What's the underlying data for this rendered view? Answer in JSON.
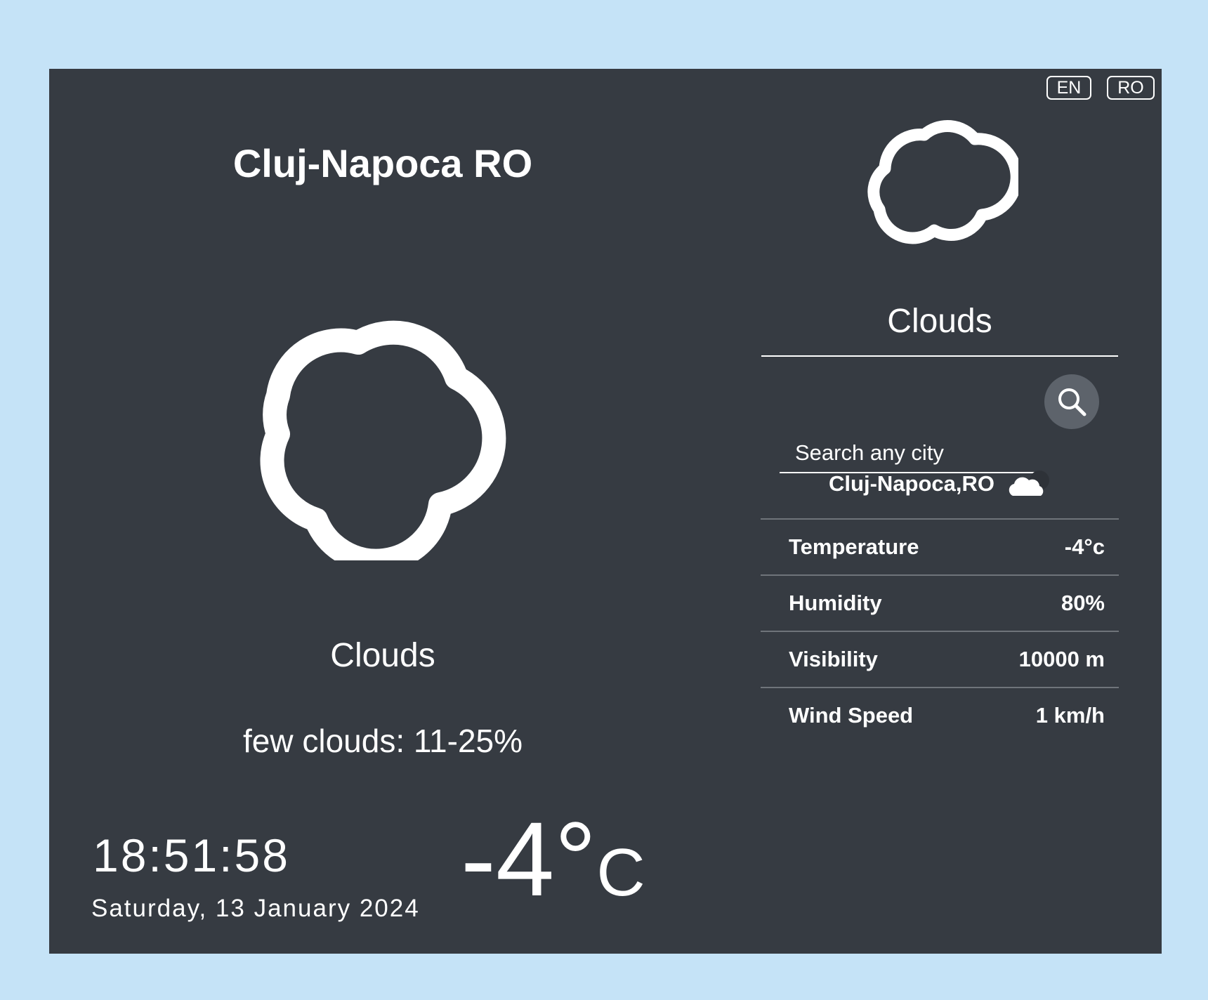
{
  "language": {
    "en": "EN",
    "ro": "RO"
  },
  "location": {
    "title": "Cluj-Napoca RO",
    "short": "Cluj-Napoca,RO"
  },
  "weather": {
    "main": "Clouds",
    "description": "few clouds: 11-25%",
    "temperature_value": "-4°",
    "temperature_unit": "C"
  },
  "datetime": {
    "time": "18:51:58",
    "date": "Saturday, 13 January 2024"
  },
  "search": {
    "placeholder": "Search any city"
  },
  "details": [
    {
      "label": "Temperature",
      "value": "-4°c"
    },
    {
      "label": "Humidity",
      "value": "80%"
    },
    {
      "label": "Visibility",
      "value": "10000 m"
    },
    {
      "label": "Wind Speed",
      "value": "1 km/h"
    }
  ],
  "icons": {
    "main_cloud": "cloud-outline-icon",
    "side_cloud": "cloud-outline-icon",
    "search": "search-icon",
    "small_cloud": "cloud-filled-icon"
  },
  "colors": {
    "background": "#c5e3f7",
    "card": "#363b42",
    "search_button": "#5d636b",
    "text": "#ffffff"
  }
}
